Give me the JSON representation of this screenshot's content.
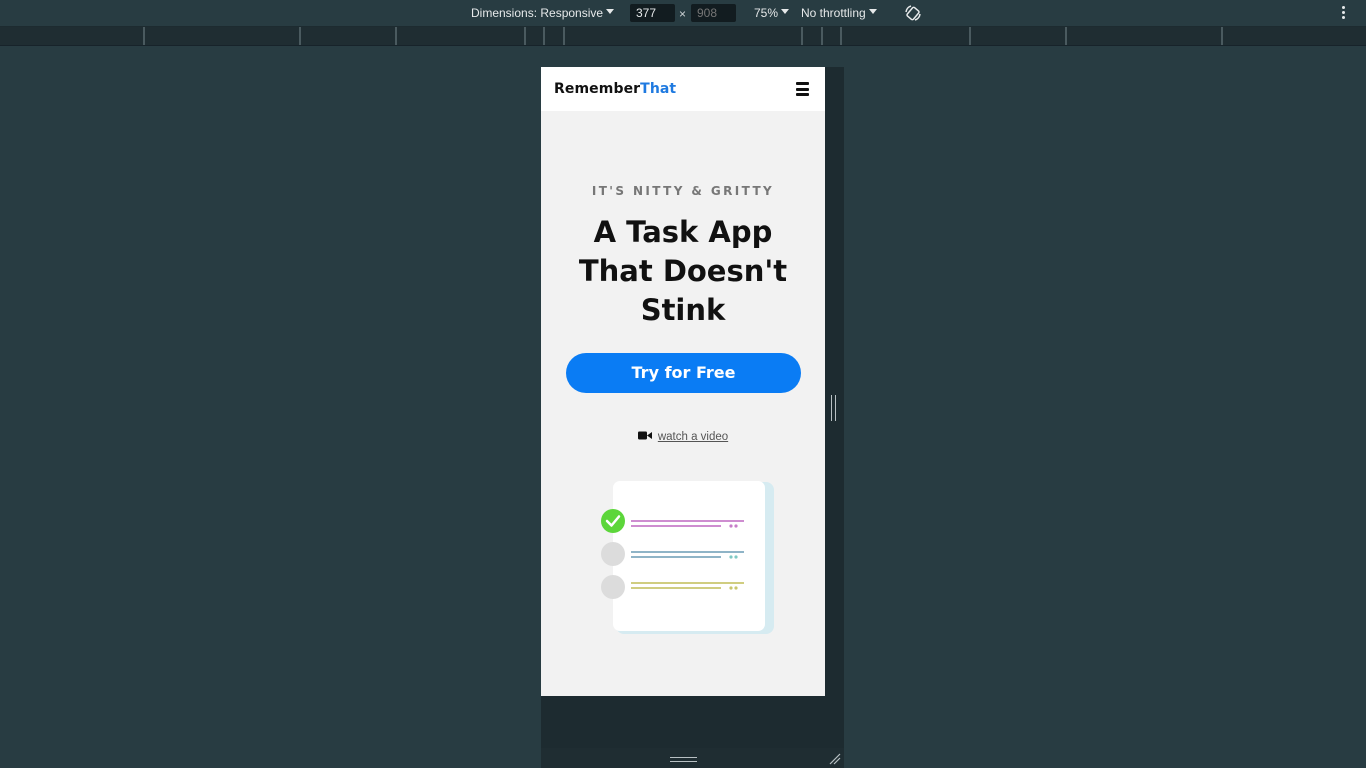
{
  "devtools": {
    "dimensions_label": "Dimensions: Responsive",
    "width_value": "377",
    "height_placeholder": "908",
    "times": "×",
    "zoom": "75%",
    "throttling": "No throttling"
  },
  "site": {
    "logo_main": "Remember",
    "logo_accent": "That",
    "eyebrow": "IT'S NITTY & GRITTY",
    "headline": "A Task App That Doesn't Stink",
    "cta_label": "Try for Free",
    "video_link": "watch a video"
  },
  "colors": {
    "accent": "#0a7cf4",
    "logo_accent": "#1f7ae0",
    "check_green": "#5cd63a",
    "devtools_bg": "#283c42"
  },
  "icons": [
    "chevron-down-icon",
    "rotate-icon",
    "more-vert-icon",
    "hamburger-menu-icon",
    "video-camera-icon",
    "check-icon"
  ]
}
